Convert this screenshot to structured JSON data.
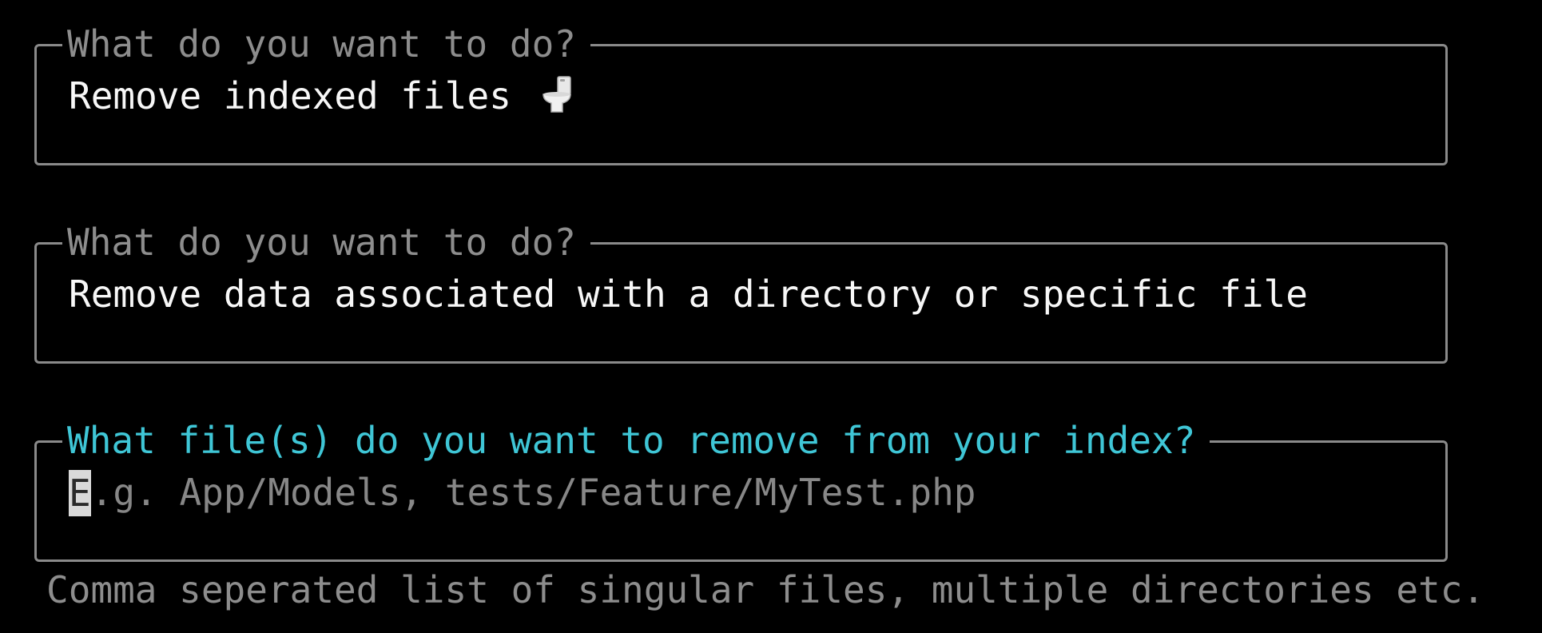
{
  "prompts": [
    {
      "label": "What do you want to do?",
      "value": "Remove indexed files ",
      "icon": "toilet-icon"
    },
    {
      "label": "What do you want to do?",
      "value": "Remove data associated with a directory or specific file"
    },
    {
      "label": "What file(s) do you want to remove from your index?",
      "cursor_char": "E",
      "placeholder_rest": ".g. App/Models, tests/Feature/MyTest.php"
    }
  ],
  "hint": "Comma seperated list of singular files, multiple directories etc.",
  "colors": {
    "background": "#000000",
    "muted": "#8d8d8d",
    "active": "#3fc6d6",
    "text": "#f7f7f7",
    "border": "#8a8a8a"
  }
}
